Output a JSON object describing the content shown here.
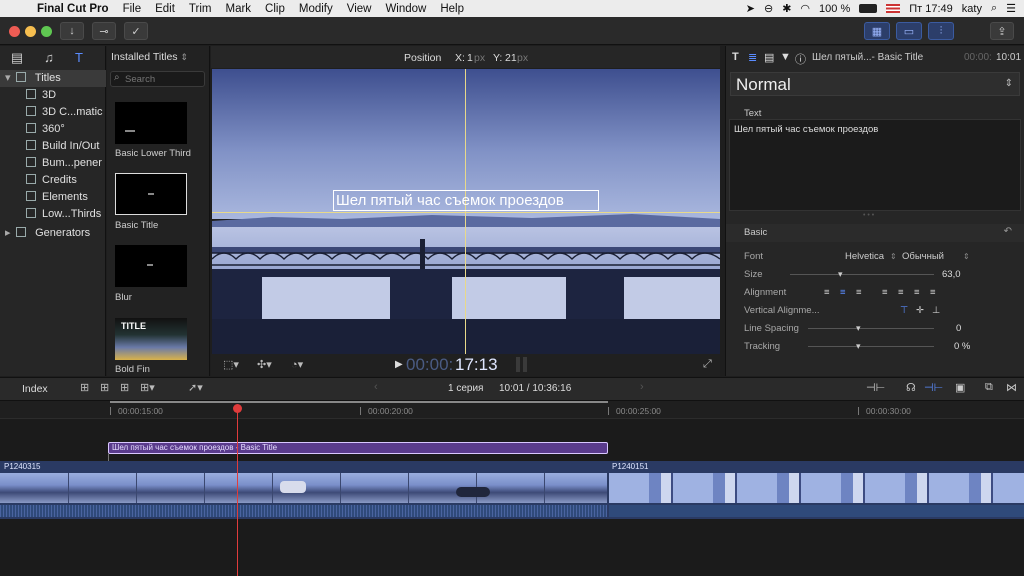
{
  "menubar": {
    "app": "Final Cut Pro",
    "items": [
      "File",
      "Edit",
      "Trim",
      "Mark",
      "Clip",
      "Modify",
      "View",
      "Window",
      "Help"
    ],
    "battery": "100 %",
    "clock": "Пт 17:49",
    "user": "katy"
  },
  "library": {
    "items": [
      {
        "label": "Titles",
        "selected": true
      },
      {
        "label": "3D"
      },
      {
        "label": "3D C...matic"
      },
      {
        "label": "360°"
      },
      {
        "label": "Build In/Out"
      },
      {
        "label": "Bum...pener"
      },
      {
        "label": "Credits"
      },
      {
        "label": "Elements"
      },
      {
        "label": "Low...Thirds"
      },
      {
        "label": "Generators"
      }
    ]
  },
  "titles_browser": {
    "dropdown": "Installed Titles",
    "search_placeholder": "Search",
    "items": [
      {
        "label": "Basic Lower Third"
      },
      {
        "label": "Basic Title"
      },
      {
        "label": "Blur"
      },
      {
        "label": "Bold Fin"
      }
    ],
    "bold_thumb_text": "TITLE"
  },
  "viewer": {
    "header_label": "Position",
    "x_label": "X:",
    "x_value": "1",
    "y_label": "Y:",
    "y_value": "21",
    "unit": "px",
    "overlay_text": "Шел пятый час съемок проездов",
    "timecode_dim": "00:00:",
    "timecode": "17:13"
  },
  "inspector": {
    "clip_title": "Шел пятый...- Basic Title",
    "duration_dim": "00:00:",
    "duration": "10:01",
    "preset": "Normal",
    "text_section": "Text",
    "text_value": "Шел пятый час съемок проездов",
    "basic_section": "Basic",
    "rows": [
      {
        "label": "Font",
        "value": "Helvetica",
        "value2": "Обычный"
      },
      {
        "label": "Size",
        "value": "63,0"
      },
      {
        "label": "Alignment"
      },
      {
        "label": "Vertical Alignme..."
      },
      {
        "label": "Line Spacing",
        "value": "0"
      },
      {
        "label": "Tracking",
        "value": "0 %"
      }
    ]
  },
  "timeline": {
    "index_label": "Index",
    "project": "1 серия",
    "position": "10:01 / 10:36:16",
    "ruler": [
      "00:00:15:00",
      "00:00:20:00",
      "00:00:25:00",
      "00:00:30:00"
    ],
    "title_clip": "Шел пятый час съемок проездов - Basic Title",
    "clip1": "P1240315",
    "clip2": "P1240151"
  },
  "colors": {
    "accent": "#3b5ba0",
    "title_clip": "#5a3b8c",
    "playhead": "#e03c3c",
    "clip_audio": "#2f4a7a"
  }
}
